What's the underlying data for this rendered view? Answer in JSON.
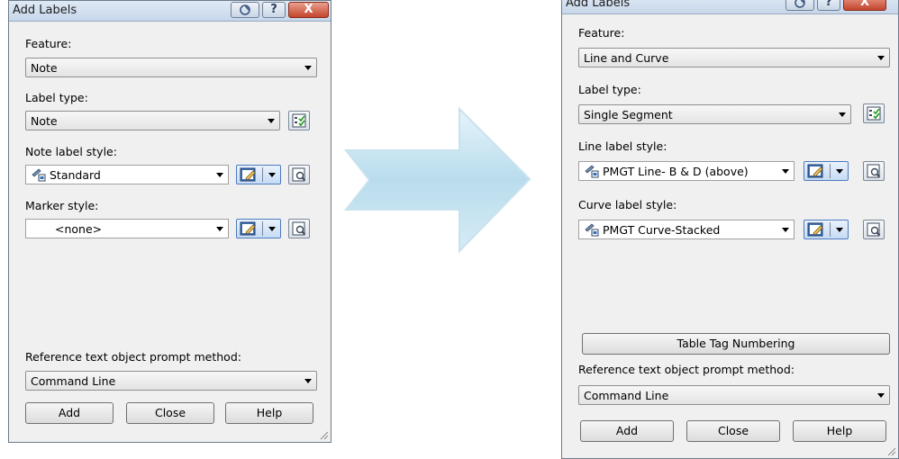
{
  "left_dialog": {
    "title": "Add Labels",
    "feature_label": "Feature:",
    "feature_value": "Note",
    "label_type_label": "Label type:",
    "label_type_value": "Note",
    "style1_label": "Note label style:",
    "style1_value": "Standard",
    "style2_label": "Marker style:",
    "style2_value": "<none>",
    "prompt_label": "Reference text object prompt method:",
    "prompt_value": "Command Line",
    "add_label": "Add",
    "close_label": "Close",
    "help_label": "Help"
  },
  "right_dialog": {
    "title": "Add Labels",
    "feature_label": "Feature:",
    "feature_value": "Line and Curve",
    "label_type_label": "Label type:",
    "label_type_value": "Single Segment",
    "style1_label": "Line label style:",
    "style1_value": "PMGT Line- B & D (above)",
    "style2_label": "Curve label style:",
    "style2_value": "PMGT Curve-Stacked",
    "table_tag_label": "Table Tag Numbering",
    "prompt_label": "Reference text object prompt method:",
    "prompt_value": "Command Line",
    "add_label": "Add",
    "close_label": "Close",
    "help_label": "Help"
  },
  "titlebar": {
    "help_glyph": "?",
    "close_glyph": "X"
  },
  "icons": [
    "style-icon",
    "label-type-icon",
    "edit-style-icon",
    "preview-icon",
    "arrow-icon",
    "resize-grip-icon"
  ],
  "colors": {
    "dialog_bg": "#f0f0f0",
    "arrow_fill": "#bfe0ee",
    "close_red": "#c4452c"
  }
}
